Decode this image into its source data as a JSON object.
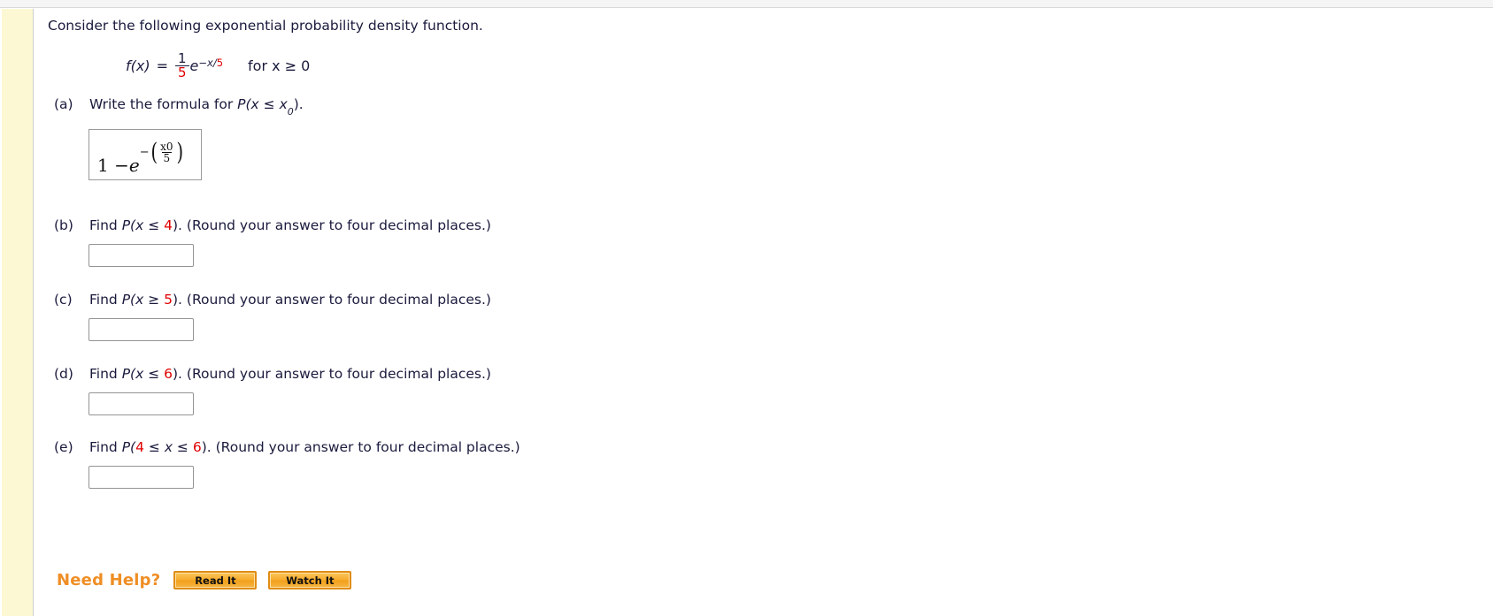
{
  "page": {
    "intro": "Consider the following exponential probability density function.",
    "accent_orange": "#ef8e24",
    "variable_red": "#e00000"
  },
  "pdf_formula": {
    "lhs": "f(x)",
    "equals": "=",
    "coefficient_numerator": "1",
    "coefficient_denominator": "5",
    "base": "e",
    "exponent_prefix": "−x/",
    "exponent_denominator": "5",
    "domain_clause": "for x ≥ 0"
  },
  "parts": [
    {
      "label": "(a)",
      "prompt_prefix": "Write the formula for ",
      "prompt_math_pre": "P(x ≤ x",
      "prompt_math_sub": "0",
      "prompt_math_post": ").",
      "answer_kind": "rendered-math",
      "answer_math": {
        "lead": "1 − ",
        "base": "e",
        "exp_minus": "−",
        "exp_open": "(",
        "exp_numerator": "x0",
        "exp_denominator": "5",
        "exp_close": ")"
      }
    },
    {
      "label": "(b)",
      "prompt_prefix": "Find ",
      "prompt_p": "P(",
      "prompt_var": "x",
      "prompt_rel": " ≤ ",
      "prompt_value": "4",
      "prompt_close": ").",
      "prompt_instruction": " (Round your answer to four decimal places.)",
      "answer_kind": "input",
      "answer_value": "",
      "answer_placeholder": ""
    },
    {
      "label": "(c)",
      "prompt_prefix": "Find ",
      "prompt_p": "P(",
      "prompt_var": "x",
      "prompt_rel": " ≥ ",
      "prompt_value": "5",
      "prompt_close": ").",
      "prompt_instruction": " (Round your answer to four decimal places.)",
      "answer_kind": "input",
      "answer_value": "",
      "answer_placeholder": ""
    },
    {
      "label": "(d)",
      "prompt_prefix": "Find ",
      "prompt_p": "P(",
      "prompt_var": "x",
      "prompt_rel": " ≤ ",
      "prompt_value": "6",
      "prompt_close": ").",
      "prompt_instruction": " (Round your answer to four decimal places.)",
      "answer_kind": "input",
      "answer_value": "",
      "answer_placeholder": ""
    },
    {
      "label": "(e)",
      "prompt_prefix": "Find ",
      "prompt_p": "P(",
      "prompt_value_low": "4",
      "prompt_rel_low": " ≤ ",
      "prompt_var": "x",
      "prompt_rel_high": " ≤ ",
      "prompt_value_high": "6",
      "prompt_close": ").",
      "prompt_instruction": " (Round your answer to four decimal places.)",
      "answer_kind": "input",
      "answer_value": "",
      "answer_placeholder": ""
    }
  ],
  "need_help": {
    "label": "Need Help?",
    "buttons": [
      {
        "label": "Read It"
      },
      {
        "label": "Watch It"
      }
    ]
  }
}
